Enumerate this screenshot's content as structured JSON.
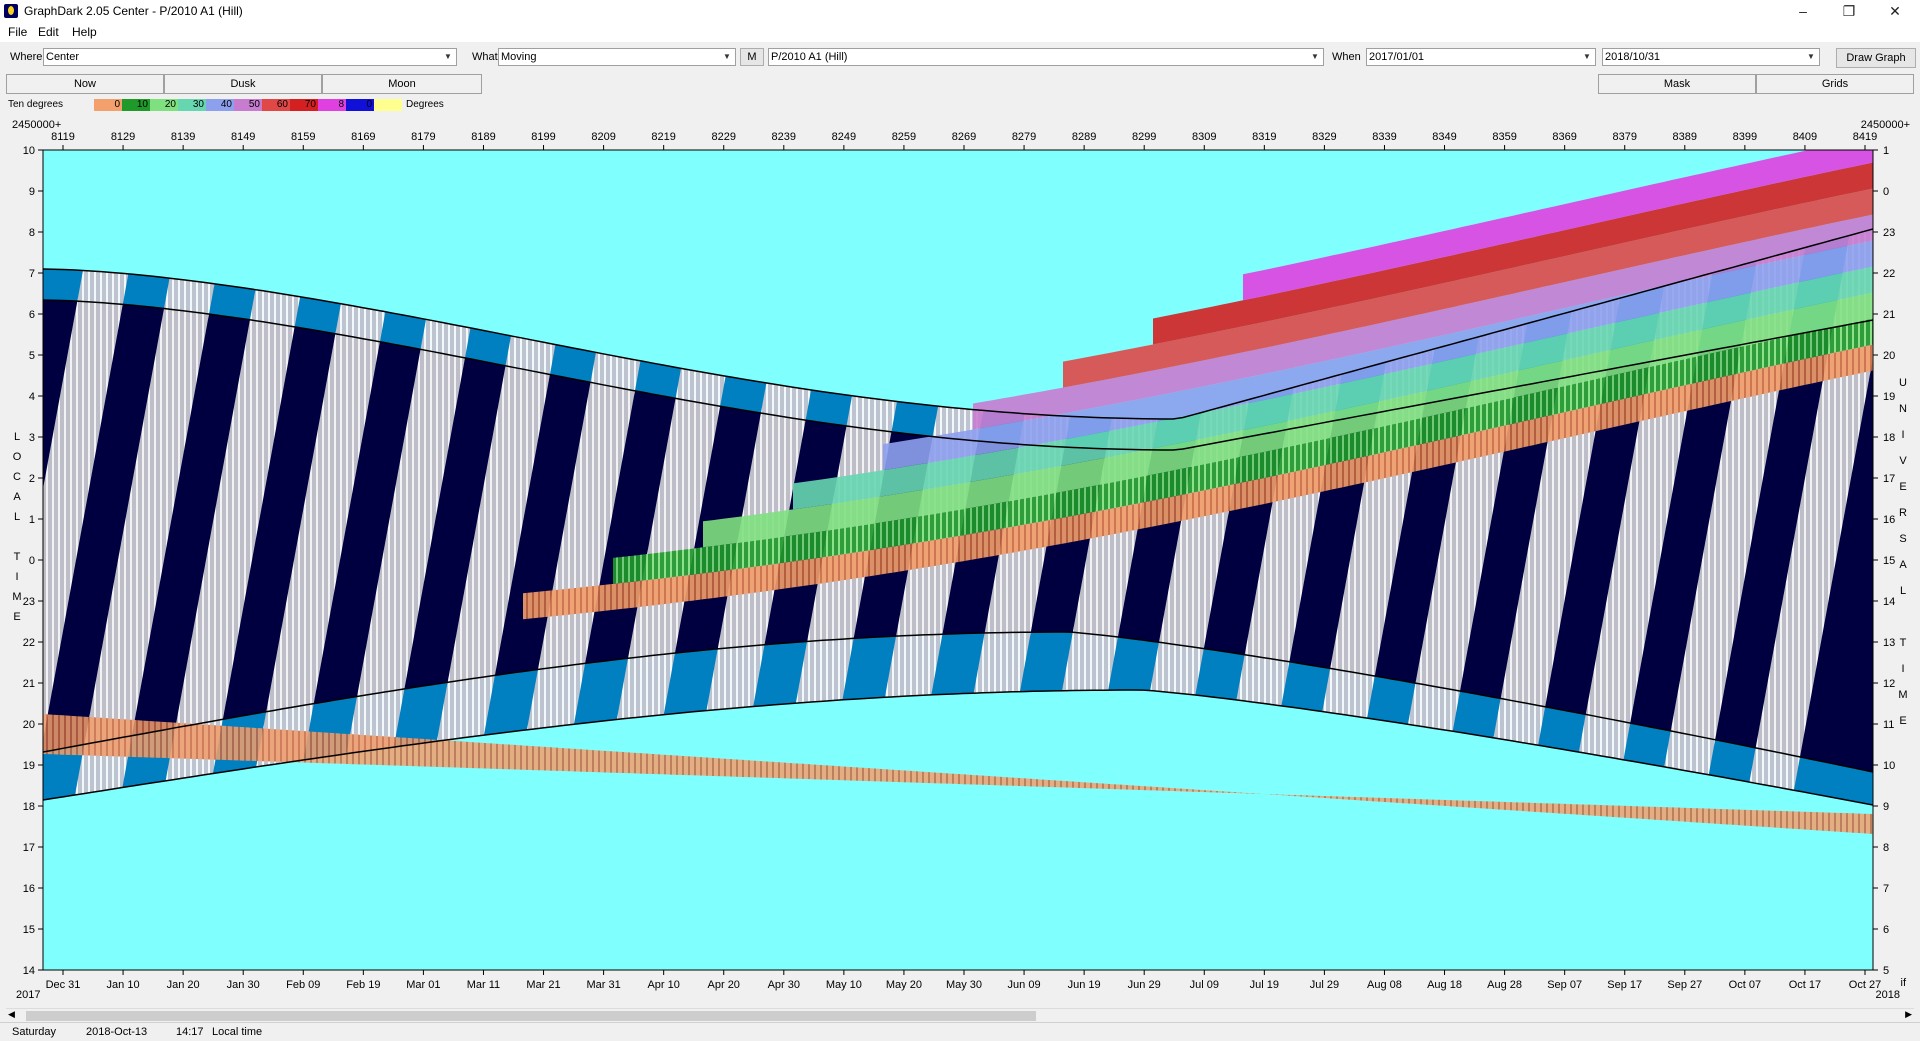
{
  "window": {
    "title": "GraphDark 2.05  Center  -  P/2010 A1 (Hill)",
    "minimize": "–",
    "restore": "❐",
    "close": "✕"
  },
  "menu": [
    "File",
    "Edit",
    "Help"
  ],
  "toolbar": {
    "where_label": "Where",
    "where_value": "Center",
    "what_label": "What",
    "what_value": "Moving",
    "m_label": "M",
    "object_value": "P/2010 A1 (Hill)",
    "when_label": "When",
    "from_value": "2017/01/01",
    "to_value": "2018/10/31",
    "draw_label": "Draw Graph"
  },
  "tabs": {
    "now": "Now",
    "dusk": "Dusk",
    "moon": "Moon",
    "mask": "Mask",
    "grids": "Grids"
  },
  "legend": {
    "label": "Ten degrees",
    "end_label": "Degrees",
    "items": [
      {
        "label": "0",
        "color": "#f4a06c"
      },
      {
        "label": "10",
        "color": "#1f9a2a"
      },
      {
        "label": "20",
        "color": "#7fe07f"
      },
      {
        "label": "30",
        "color": "#66d6b0"
      },
      {
        "label": "40",
        "color": "#8da0ee"
      },
      {
        "label": "50",
        "color": "#c87cd0"
      },
      {
        "label": "60",
        "color": "#e04848"
      },
      {
        "label": "70",
        "color": "#d42020"
      },
      {
        "label": "8",
        "color": "#e040e0"
      },
      {
        "label": "0",
        "color": "#1010d8"
      },
      {
        "label": "",
        "color": "#ffff90"
      }
    ]
  },
  "chart_data": {
    "type": "heatmap",
    "jd_base_left": "2450000+",
    "jd_base_right": "2450000+",
    "jd_ticks": [
      "8119",
      "8129",
      "8139",
      "8149",
      "8159",
      "8169",
      "8179",
      "8189",
      "8199",
      "8209",
      "8219",
      "8229",
      "8239",
      "8249",
      "8259",
      "8269",
      "8279",
      "8289",
      "8299",
      "8309",
      "8319",
      "8329",
      "8339",
      "8349",
      "8359",
      "8369",
      "8379",
      "8389",
      "8399",
      "8409",
      "8419"
    ],
    "date_ticks": [
      "Dec 31",
      "Jan 10",
      "Jan 20",
      "Jan 30",
      "Feb 09",
      "Feb 19",
      "Mar 01",
      "Mar 11",
      "Mar 21",
      "Mar 31",
      "Apr 10",
      "Apr 20",
      "Apr 30",
      "May 10",
      "May 20",
      "May 30",
      "Jun 09",
      "Jun 19",
      "Jun 29",
      "Jul 09",
      "Jul 19",
      "Jul 29",
      "Aug 08",
      "Aug 18",
      "Aug 28",
      "Sep 07",
      "Sep 17",
      "Sep 27",
      "Oct 07",
      "Oct 17",
      "Oct 27"
    ],
    "year_left": "2017",
    "year_right": "2018",
    "corner_right": "if",
    "left_ticks": [
      "10",
      "9",
      "8",
      "7",
      "6",
      "5",
      "4",
      "3",
      "2",
      "1",
      "0",
      "23",
      "22",
      "21",
      "20",
      "19",
      "18",
      "17",
      "16",
      "15",
      "14"
    ],
    "right_ticks": [
      "1",
      "0",
      "23",
      "22",
      "21",
      "20",
      "19",
      "18",
      "17",
      "16",
      "15",
      "14",
      "13",
      "12",
      "11",
      "10",
      "9",
      "8",
      "7",
      "6",
      "5"
    ],
    "left_axis_label": [
      "L",
      "O",
      "C",
      "A",
      "L",
      "",
      "T",
      "I",
      "M",
      "E"
    ],
    "right_axis_label": [
      "U",
      "N",
      "I",
      "V",
      "E",
      "R",
      "S",
      "A",
      "L",
      "",
      "T",
      "I",
      "M",
      "E"
    ],
    "colors": {
      "day": "#80ffff",
      "twilight": "#0080c0",
      "night": "#000040",
      "moon": "#c8c8d0"
    }
  },
  "status": {
    "weekday": "Saturday",
    "date": "2018-Oct-13",
    "time": "14:17",
    "time_label": "Local time"
  }
}
